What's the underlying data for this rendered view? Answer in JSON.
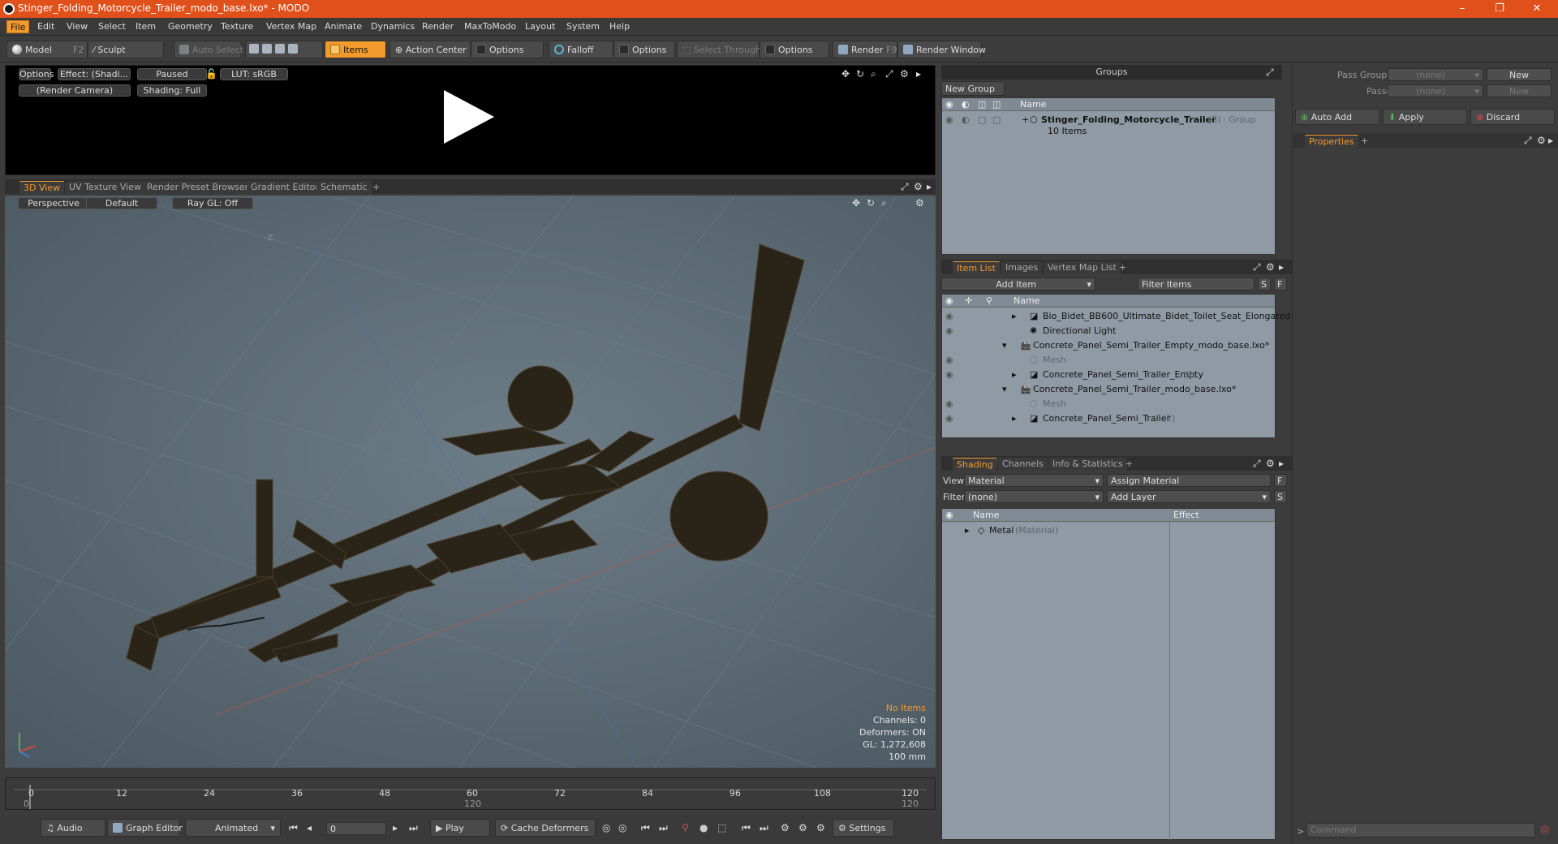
{
  "window": {
    "title": "Stinger_Folding_Motorcycle_Trailer_modo_base.lxo* - MODO",
    "minimize": "–",
    "restore": "❐",
    "close": "✕"
  },
  "menu": [
    "File",
    "Edit",
    "View",
    "Select",
    "Item",
    "Geometry",
    "Texture",
    "Vertex Map",
    "Animate",
    "Dynamics",
    "Render",
    "MaxToModo",
    "Layout",
    "System",
    "Help"
  ],
  "toolbar": {
    "model": "Model",
    "model_key": "F2",
    "sculpt": "Sculpt",
    "auto_select": "Auto Select",
    "items": "Items",
    "action_center": "Action Center",
    "options1": "Options",
    "falloff": "Falloff",
    "options2": "Options",
    "select_through": "Select Through",
    "options3": "Options",
    "render": "Render",
    "render_key": "F9",
    "render_window": "Render Window"
  },
  "render_view": {
    "options": "Options",
    "effect": "Effect: (Shadi...",
    "paused": "Paused",
    "lut": "LUT: sRGB",
    "camera": "(Render Camera)",
    "shading": "Shading: Full"
  },
  "viewport_tabs": [
    "3D View",
    "UV Texture View",
    "Render Preset Browser",
    "Gradient Editor",
    "Schematic"
  ],
  "viewport": {
    "perspective": "Perspective",
    "default": "Default",
    "raygl": "Ray GL: Off",
    "axis_label": "-Z",
    "stats": {
      "items": "No Items",
      "channels": "Channels: 0",
      "deformers": "Deformers: ON",
      "gl": "GL: 1,272,608",
      "scale": "100 mm"
    }
  },
  "timeline": {
    "ticks": [
      "0",
      "12",
      "24",
      "36",
      "48",
      "60",
      "72",
      "84",
      "96",
      "108",
      "120"
    ],
    "start": "0",
    "mid": "120",
    "end": "120"
  },
  "bottombar": {
    "audio": "Audio",
    "graph_editor": "Graph Editor",
    "animated": "Animated",
    "frame": "0",
    "play": "Play",
    "cache": "Cache Deformers",
    "settings": "Settings"
  },
  "groups": {
    "title": "Groups",
    "new_group": "New Group",
    "col_name": "Name",
    "item_name": "Stinger_Folding_Motorcycle_Trailer",
    "item_count": "(3)",
    "item_type": ": Group",
    "item_sub": "10 Items"
  },
  "itemlist": {
    "tabs": [
      "Item List",
      "Images",
      "Vertex Map List"
    ],
    "add_item": "Add Item",
    "filter": "Filter Items",
    "s": "S",
    "f": "F",
    "col_name": "Name",
    "rows": [
      {
        "label": "Bio_Bidet_BB600_Ultimate_Bidet_Toilet_Seat_Elongated",
        "extra": ""
      },
      {
        "label": "Directional Light",
        "extra": ""
      },
      {
        "label": "Concrete_Panel_Semi_Trailer_Empty_modo_base.lxo*",
        "extra": ""
      },
      {
        "label": "Mesh",
        "extra": ""
      },
      {
        "label": "Concrete_Panel_Semi_Trailer_Empty",
        "extra": "(2)"
      },
      {
        "label": "Concrete_Panel_Semi_Trailer_modo_base.lxo*",
        "extra": ""
      },
      {
        "label": "Mesh",
        "extra": ""
      },
      {
        "label": "Concrete_Panel_Semi_Trailer",
        "extra": "(2)"
      }
    ]
  },
  "shading": {
    "tabs": [
      "Shading",
      "Channels",
      "Info & Statistics"
    ],
    "view_label": "View",
    "view_value": "Material",
    "assign": "Assign Material",
    "filter_label": "Filter",
    "filter_value": "(none)",
    "add_layer": "Add Layer",
    "col_name": "Name",
    "col_effect": "Effect",
    "row_name": "Metal",
    "row_type": "(Material)"
  },
  "right": {
    "pass_groups": "Pass Groups",
    "pass_groups_value": "(none)",
    "new1": "New",
    "passes": "Passes",
    "passes_value": "(none)",
    "new2": "New",
    "auto_add": "Auto Add",
    "apply": "Apply",
    "discard": "Discard",
    "properties": "Properties",
    "command": "Command"
  }
}
